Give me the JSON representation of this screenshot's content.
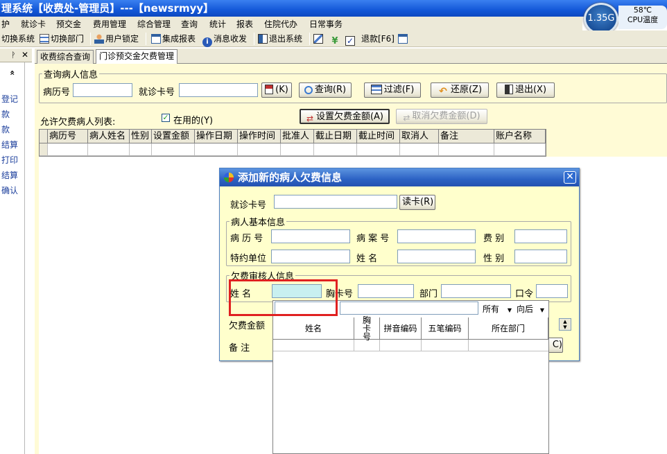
{
  "window": {
    "title": "理系统【收费处-管理员】---【newsrmyy】"
  },
  "widgets": {
    "ram": "1.35G",
    "cpu_temp": "58℃",
    "cpu_label": "CPU温度"
  },
  "menu": [
    "护",
    "就诊卡",
    "预交金",
    "费用管理",
    "综合管理",
    "查询",
    "统计",
    "报表",
    "住院代办",
    "日常事务"
  ],
  "toolbar": {
    "switch_system": "切换系统",
    "switch_dept": "切换部门",
    "lock_user": "用户锁定",
    "report": "集成报表",
    "message": "消息收发",
    "exit": "退出系统",
    "refund": "退款[F6]"
  },
  "left_panel": {
    "pin": "ᚹ",
    "close": "✕",
    "collapse": "«",
    "links": [
      "登记",
      "款",
      "款",
      "结算",
      "打印",
      "结算",
      "确认"
    ]
  },
  "tabs": [
    "收费综合查询",
    "门诊预交金欠费管理"
  ],
  "query_group": {
    "legend": "查询病人信息",
    "record_no_label": "病历号",
    "card_no_label": "就诊卡号",
    "read_card_btn": "(K)",
    "search_btn": "查询(R)",
    "filter_btn": "过滤(F)",
    "restore_btn": "还原(Z)",
    "exit_btn": "退出(X)"
  },
  "list_bar": {
    "label": "允许欠费病人列表:",
    "in_use_label": "在用的(Y)",
    "in_use_checked": true,
    "set_amount_btn": "设置欠费金额(A)",
    "cancel_amount_btn": "取消欠费金额(D)"
  },
  "grid": {
    "columns": [
      "病历号",
      "病人姓名",
      "性别",
      "设置金额",
      "操作日期",
      "操作时间",
      "批准人",
      "截止日期",
      "截止时间",
      "取消人",
      "备注",
      "账户名称"
    ]
  },
  "dialog": {
    "title": "添加新的病人欠费信息",
    "card_no_label": "就诊卡号",
    "read_card_btn": "读卡(R)",
    "patient_group": {
      "legend": "病人基本信息",
      "record_no_label": "病 历 号",
      "case_no_label": "病 案 号",
      "fee_type_label": "费   别",
      "unit_label": "特约单位",
      "name_label": "姓    名",
      "gender_label": "性   别"
    },
    "approver_group": {
      "legend": "欠费审核人信息",
      "name_label": "姓    名",
      "badge_label": "胸卡号",
      "dept_label": "部门",
      "password_label": "口令"
    },
    "amount_label": "欠费金额",
    "remark_label": "备    注",
    "confirm_btn_tail": "C)"
  },
  "lookup": {
    "match_mode": "所有",
    "match_pos": "向后",
    "columns": [
      "姓名",
      "胸卡号",
      "拼音编码",
      "五笔编码",
      "所在部门"
    ]
  }
}
